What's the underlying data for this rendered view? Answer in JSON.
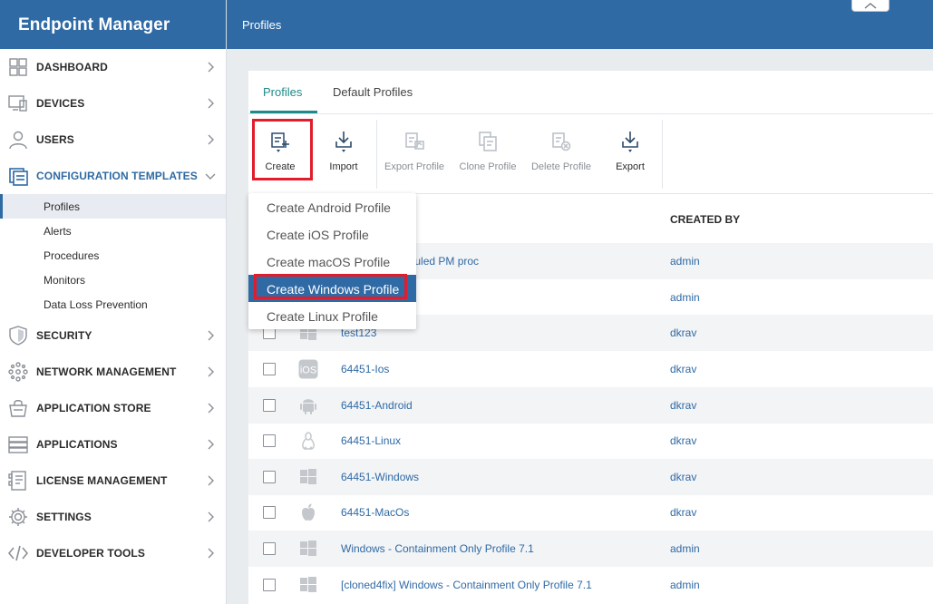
{
  "app": {
    "title": "Endpoint Manager",
    "page_title": "Profiles"
  },
  "sidebar": {
    "items": [
      {
        "label": "DASHBOARD",
        "icon": "dashboard-icon"
      },
      {
        "label": "DEVICES",
        "icon": "devices-icon"
      },
      {
        "label": "USERS",
        "icon": "user-icon"
      },
      {
        "label": "CONFIGURATION TEMPLATES",
        "icon": "configuration-icon",
        "expanded": true
      },
      {
        "label": "SECURITY",
        "icon": "shield-icon"
      },
      {
        "label": "NETWORK MANAGEMENT",
        "icon": "network-icon"
      },
      {
        "label": "APPLICATION STORE",
        "icon": "store-icon"
      },
      {
        "label": "APPLICATIONS",
        "icon": "applications-icon"
      },
      {
        "label": "LICENSE MANAGEMENT",
        "icon": "license-icon"
      },
      {
        "label": "SETTINGS",
        "icon": "gear-icon"
      },
      {
        "label": "DEVELOPER TOOLS",
        "icon": "code-icon"
      }
    ],
    "subitems": [
      {
        "label": "Profiles",
        "selected": true
      },
      {
        "label": "Alerts"
      },
      {
        "label": "Procedures"
      },
      {
        "label": "Monitors"
      },
      {
        "label": "Data Loss Prevention"
      }
    ]
  },
  "tabs": [
    {
      "label": "Profiles",
      "active": true
    },
    {
      "label": "Default Profiles"
    }
  ],
  "toolbar": {
    "create": "Create",
    "import": "Import",
    "export_profile": "Export Profile",
    "clone_profile": "Clone Profile",
    "delete_profile": "Delete Profile",
    "export": "Export"
  },
  "table": {
    "headers": {
      "created_by": "CREATED BY"
    },
    "rows": [
      {
        "os": "windows",
        "name": "MW with scheduled PM proc",
        "created_by": "admin"
      },
      {
        "os": "windows",
        "name": "",
        "created_by": "admin"
      },
      {
        "os": "windows",
        "name": "test123",
        "created_by": "dkrav"
      },
      {
        "os": "ios",
        "name": "64451-Ios",
        "created_by": "dkrav"
      },
      {
        "os": "android",
        "name": "64451-Android",
        "created_by": "dkrav"
      },
      {
        "os": "linux",
        "name": "64451-Linux",
        "created_by": "dkrav"
      },
      {
        "os": "windows",
        "name": "64451-Windows",
        "created_by": "dkrav"
      },
      {
        "os": "apple",
        "name": "64451-MacOs",
        "created_by": "dkrav"
      },
      {
        "os": "windows",
        "name": "Windows - Containment Only Profile 7.1",
        "created_by": "admin"
      },
      {
        "os": "windows",
        "name": "[cloned4fix] Windows - Containment Only Profile 7.1",
        "created_by": "admin"
      }
    ]
  },
  "create_menu": {
    "items": [
      {
        "label": "Create Android Profile"
      },
      {
        "label": "Create iOS Profile"
      },
      {
        "label": "Create macOS Profile"
      },
      {
        "label": "Create Windows Profile",
        "highlighted": true
      },
      {
        "label": "Create Linux Profile"
      }
    ]
  },
  "colors": {
    "brand": "#2f6aa5",
    "accent_tab": "#1f8a8a",
    "highlight_border": "#e21c2b"
  }
}
